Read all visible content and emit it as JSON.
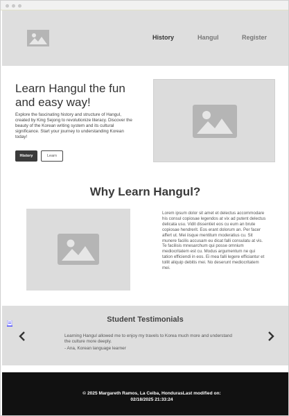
{
  "nav": {
    "logo_icon": "image-placeholder-icon",
    "items": [
      {
        "label": "History",
        "active": true
      },
      {
        "label": "Hangul",
        "active": false
      },
      {
        "label": "Register",
        "active": false
      }
    ]
  },
  "hero": {
    "title": "Learn Hangul the fun and easy way!",
    "description": "Explore the fascinating history and structure of Hangul, created by King Sejong to revolutionize literacy. Discover the beauty of the Korean writing system and its cultural significance. Start your journey to understanding Korean today!",
    "primary_button": "History",
    "secondary_button": "Learn",
    "image_icon": "image-placeholder-icon"
  },
  "why": {
    "title": "Why Learn Hangul?",
    "image_icon": "image-placeholder-icon",
    "body": "Lorem ipsum dolor sit amet et delectus accommodare his consul copiosae legendos at vix ad putent delectus delicata usu. Vidit dissentiet eos cu eum an brute copiosae hendrerit. Eos erant dolorum an. Per facer affert ut. Mei iisque mentitum moderatius cu. Sit munere facilis accusam eu dicat falli consulatu at vis. Te facilisis mnesarchum qui posse omnium mediocritatem est cu. Modus argumentum ne qui tation efficiendi in eos. Ei mea falli legere efficiantur et tollit aliquip debitis mei. No deserunt mediocritatem mei."
  },
  "testimonials": {
    "title": "Student Testimonials",
    "quote": "Learning Hangul allowed me to enjoy my travels to Korea much more and understand the culture more deeply.",
    "author": "- Ana, Korean language learner",
    "prev_icon": "chevron-left-icon",
    "next_icon": "chevron-right-icon"
  },
  "footer": {
    "text": "© 2025 Margareth Ramos, La Ceiba, HondurasLast modified on: 02/18/2025 21:33:24"
  },
  "colors": {
    "header_bg": "#dedede",
    "footer_bg": "#111111",
    "placeholder_bg": "#dcdcdc",
    "button_dark": "#3b3b3b"
  }
}
